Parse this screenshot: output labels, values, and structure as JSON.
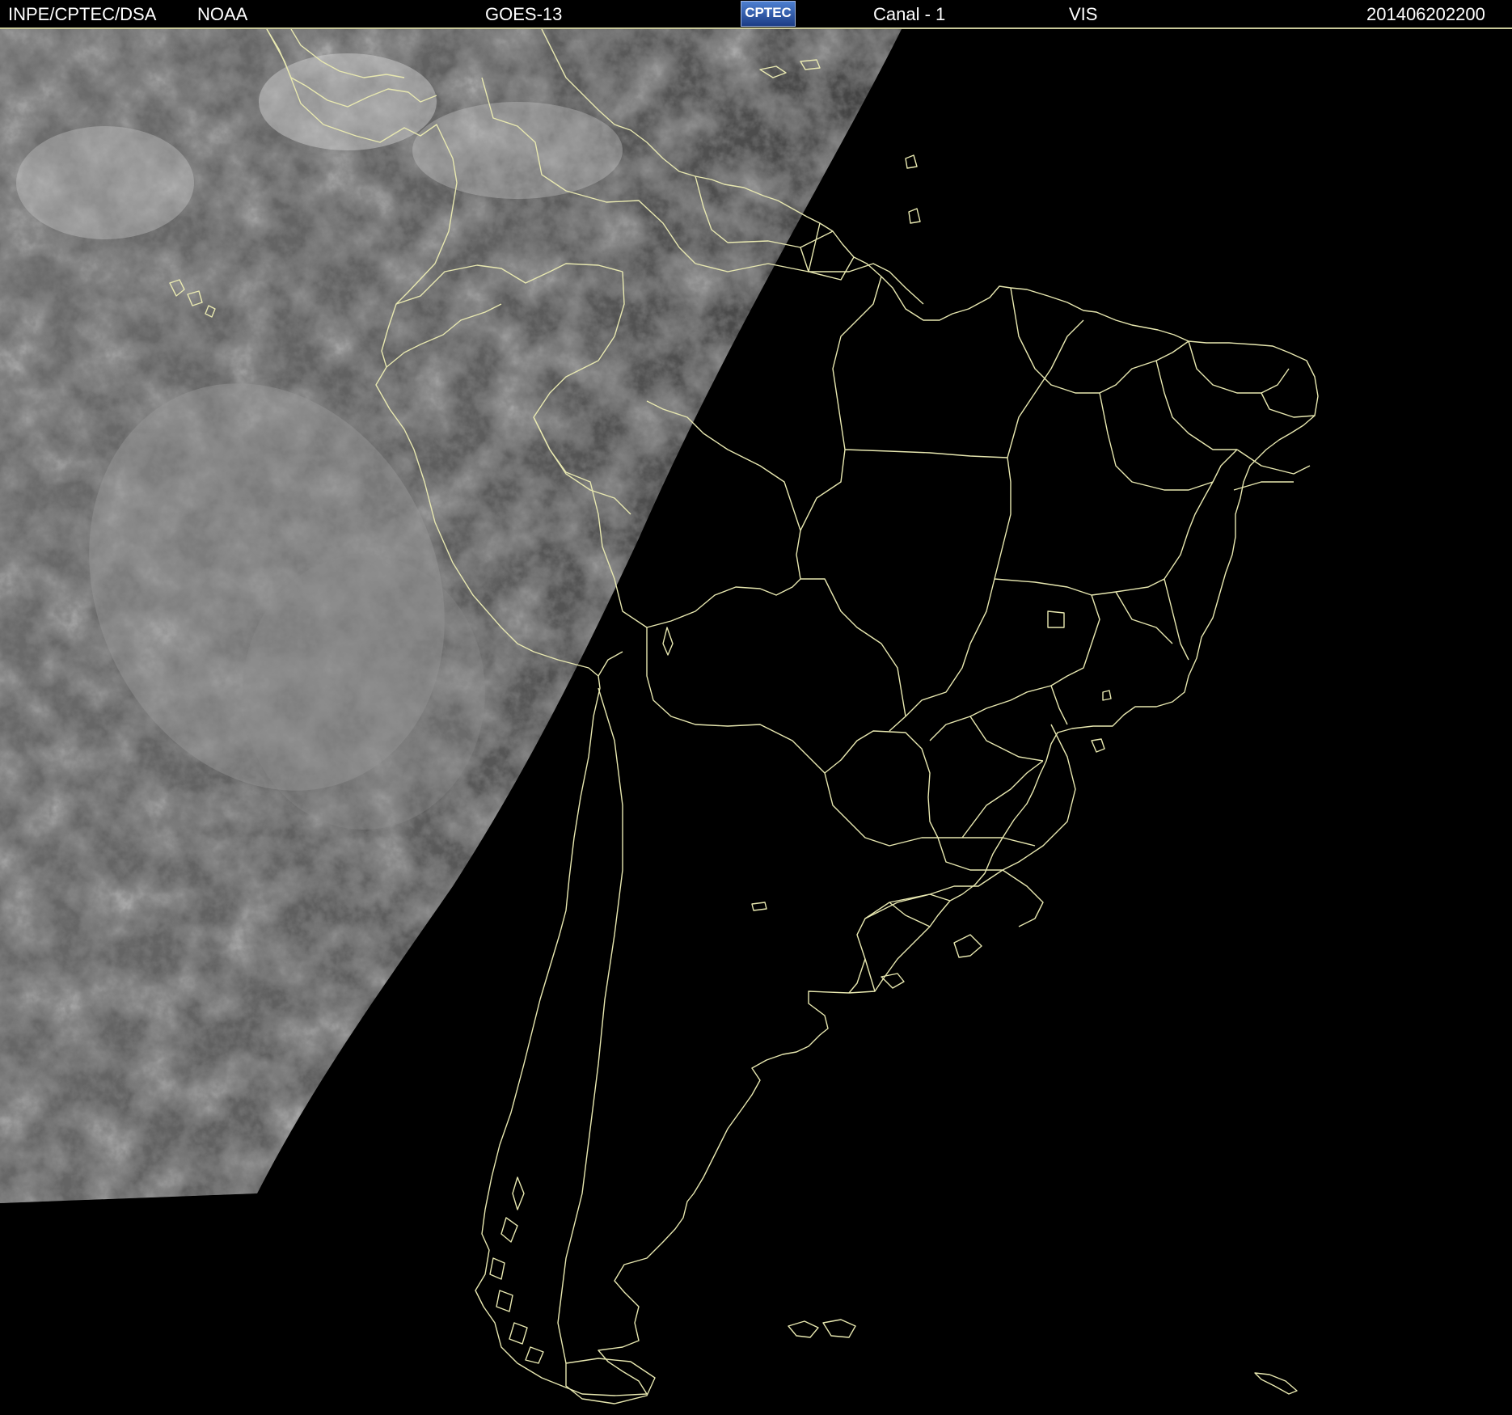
{
  "header": {
    "institution": "INPE/CPTEC/DSA",
    "agency": "NOAA",
    "satellite": "GOES-13",
    "logo_text": "CPTEC",
    "channel": "Canal - 1",
    "band": "VIS",
    "timestamp": "201406202200"
  },
  "colors": {
    "background": "#000000",
    "border_lines": "#e8e8b0",
    "header_text": "#ffffff",
    "logo": "#2c5bb0"
  },
  "map": {
    "region": "South America",
    "imagery": "visible satellite image, daylit western half with clouds, night-side eastern half black"
  }
}
